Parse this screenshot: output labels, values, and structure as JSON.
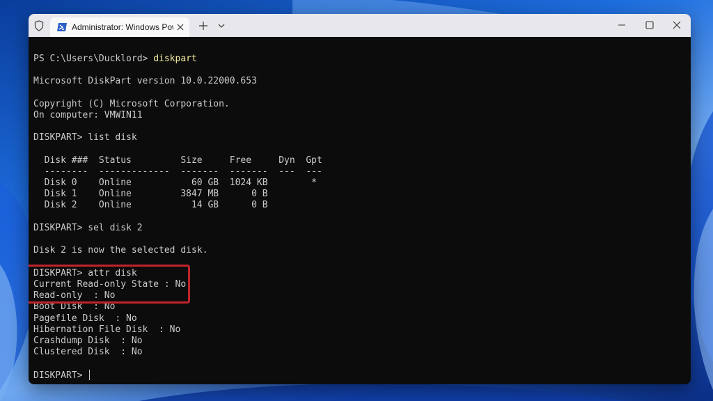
{
  "window": {
    "tab_title": "Administrator: Windows PowerShell"
  },
  "icons": {
    "shield": "shield-icon",
    "powershell": "powershell-icon",
    "tab_close": "close-icon",
    "new_tab": "plus-icon",
    "dropdown": "chevron-down-icon",
    "minimize": "minimize-icon",
    "maximize": "maximize-icon",
    "close": "close-icon"
  },
  "colors": {
    "terminal_bg": "#0c0c0c",
    "terminal_text": "#cccccc",
    "command_text": "#f9f1a5",
    "highlight_border": "#c0242b"
  },
  "terminal": {
    "prompt_ps": "PS C:\\Users\\Ducklord> ",
    "cmd_diskpart": "diskpart",
    "version": "Microsoft DiskPart version 10.0.22000.653",
    "copyright": "Copyright (C) Microsoft Corporation.",
    "computer": "On computer: VMWIN11",
    "cmd_list_disk": "DISKPART> list disk",
    "table_header": "  Disk ###  Status         Size     Free     Dyn  Gpt",
    "table_separator": "  --------  -------------  -------  -------  ---  ---",
    "table_rows": [
      "  Disk 0    Online           60 GB  1024 KB        *",
      "  Disk 1    Online         3847 MB      0 B",
      "  Disk 2    Online           14 GB      0 B"
    ],
    "cmd_sel_disk": "DISKPART> sel disk 2",
    "sel_result": "Disk 2 is now the selected disk.",
    "cmd_attr_disk": "DISKPART> attr disk",
    "attr_lines": [
      "Current Read-only State : No",
      "Read-only  : No",
      "Boot Disk  : No",
      "Pagefile Disk  : No",
      "Hibernation File Disk  : No",
      "Crashdump Disk  : No",
      "Clustered Disk  : No"
    ],
    "final_prompt": "DISKPART> "
  }
}
